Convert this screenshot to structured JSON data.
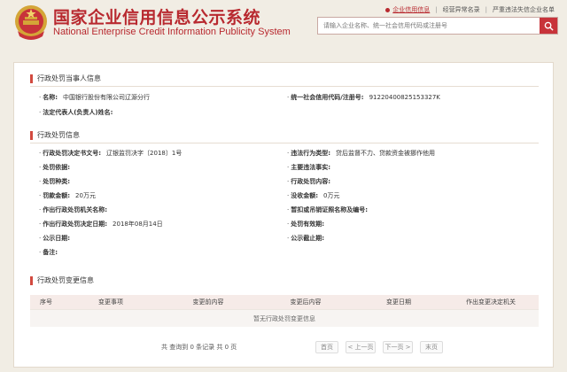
{
  "header": {
    "title": "国家企业信用信息公示系统",
    "subtitle": "National Enterprise Credit Information Publicity System",
    "nav": [
      "企业信用信息",
      "经营异常名录",
      "严重违法失信企业名单"
    ],
    "search_placeholder": "请输入企业名称、统一社会信用代码或注册号",
    "colors": {
      "brand": "#b8292f",
      "search_button": "#c8333a"
    }
  },
  "party": {
    "title": "行政处罚当事人信息",
    "fields": [
      {
        "label": "名称:",
        "value": "中国银行股份有限公司辽源分行"
      },
      {
        "label": "统一社会信用代码/注册号:",
        "value": "91220400825153327K"
      },
      {
        "label": "法定代表人(负责人)姓名:",
        "value": ""
      }
    ]
  },
  "penalty": {
    "title": "行政处罚信息",
    "left": [
      {
        "label": "行政处罚决定书文号:",
        "value": "辽银监罚决字〔2018〕1号"
      },
      {
        "label": "处罚依据:",
        "value": ""
      },
      {
        "label": "处罚种类:",
        "value": ""
      },
      {
        "label": "罚款金额:",
        "value": "20万元"
      },
      {
        "label": "作出行政处罚机关名称:",
        "value": ""
      },
      {
        "label": "作出行政处罚决定日期:",
        "value": "2018年08月14日"
      },
      {
        "label": "公示日期:",
        "value": ""
      },
      {
        "label": "备注:",
        "value": ""
      }
    ],
    "right": [
      {
        "label": "违法行为类型:",
        "value": "贷后监督不力、贷款资金被挪作他用"
      },
      {
        "label": "主要违法事实:",
        "value": ""
      },
      {
        "label": "行政处罚内容:",
        "value": ""
      },
      {
        "label": "没收金额:",
        "value": "0万元"
      },
      {
        "label": "暂扣或吊销证照名称及编号:",
        "value": ""
      },
      {
        "label": "处罚有效期:",
        "value": ""
      },
      {
        "label": "公示截止期:",
        "value": ""
      }
    ]
  },
  "changes": {
    "title": "行政处罚变更信息",
    "columns": [
      "序号",
      "变更事项",
      "变更前内容",
      "变更后内容",
      "变更日期",
      "作出变更决定机关"
    ],
    "empty_text": "暂无行政处罚变更信息",
    "summary": "共 查询到 0 条记录 共 0 页",
    "pager": [
      "首页",
      "< 上一页",
      "下一页 >",
      "末页"
    ]
  }
}
